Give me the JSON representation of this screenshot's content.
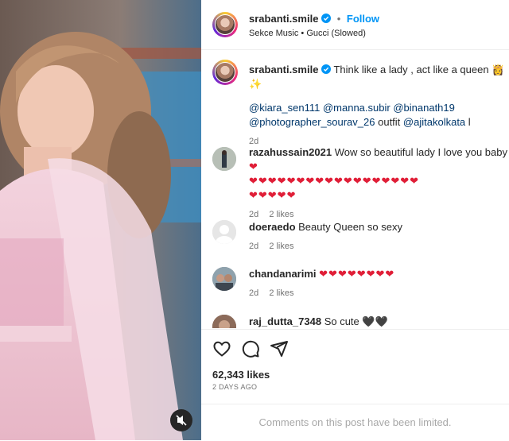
{
  "header": {
    "username": "srabanti.smile",
    "dot": "•",
    "follow_label": "Follow",
    "audio": "Sekce Music • Gucci (Slowed)"
  },
  "caption": {
    "username": "srabanti.smile",
    "text": "Think like a lady , act like a queen 👸 ✨",
    "mention1": "@kiara_sen111",
    "mention2": "@manna.subir",
    "mention3": "@binanath19",
    "mention4": "@photographer_sourav_26",
    "outfit": "outfit",
    "mention5": "@ajitakolkata",
    "tail": "l",
    "time": "2d"
  },
  "comments": [
    {
      "username": "razahussain2021",
      "text": "Wow so beautiful lady I love you baby",
      "hearts1": "❤",
      "hearts2": "❤❤❤❤❤❤❤❤❤❤❤❤❤❤❤❤❤❤",
      "hearts3": "❤❤❤❤❤",
      "time": "2d",
      "likes": "2 likes"
    },
    {
      "username": "doeraedo",
      "text": "Beauty Queen so sexy",
      "time": "2d",
      "likes": "2 likes"
    },
    {
      "username": "chandanarimi",
      "hearts": "❤❤❤❤❤❤❤❤",
      "time": "2d",
      "likes": "2 likes"
    },
    {
      "username": "raj_dutta_7348",
      "text": "So cute",
      "hearts": "🖤🖤"
    }
  ],
  "post": {
    "likes": "62,343 likes",
    "ago": "2 DAYS AGO",
    "limited": "Comments on this post have been limited."
  },
  "icons": {
    "like": "heart-outline-icon",
    "comment": "comment-icon",
    "share": "share-icon",
    "mute": "audio-muted-icon",
    "verified": "verified-badge-icon"
  },
  "colors": {
    "accent": "#0095f6",
    "verified": "#0095f6",
    "heart": "#e01e37"
  }
}
